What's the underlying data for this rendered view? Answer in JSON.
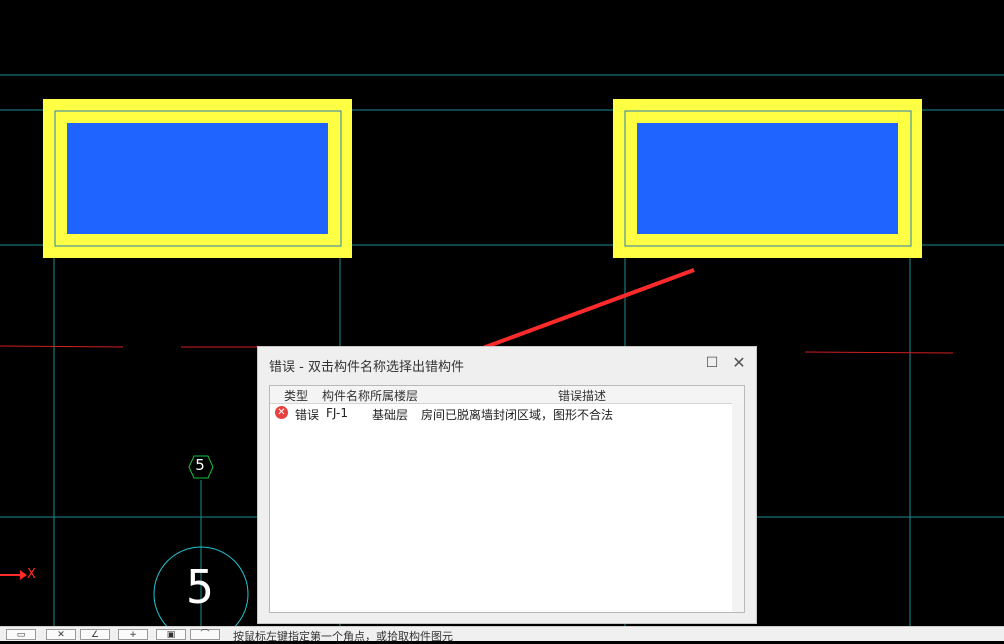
{
  "colors": {
    "background": "#000000",
    "grid_line": "#1e8b93",
    "slab_outline": "#ffff44",
    "slab_fill": "#1f64ff",
    "annotation_arrow": "#ff2a2a"
  },
  "drawing": {
    "axis_label": "X",
    "axis_marker_small": "5",
    "axis_marker_big": "5"
  },
  "dialog": {
    "title": "错误 - 双击构件名称选择出错构件",
    "maximize_icon": "maximize-icon",
    "close_icon": "close-icon",
    "columns": [
      "类型",
      "构件名称",
      "所属楼层",
      "错误描述"
    ],
    "rows": [
      {
        "icon": "error-circle-icon",
        "type": "错误",
        "name": "FJ-1",
        "floor": "基础层",
        "description": "房间已脱离墙封闭区域，图形不合法"
      }
    ]
  },
  "toolbar": {
    "status_text": "按鼠标左键指定第一个角点，或拾取构件图元"
  }
}
